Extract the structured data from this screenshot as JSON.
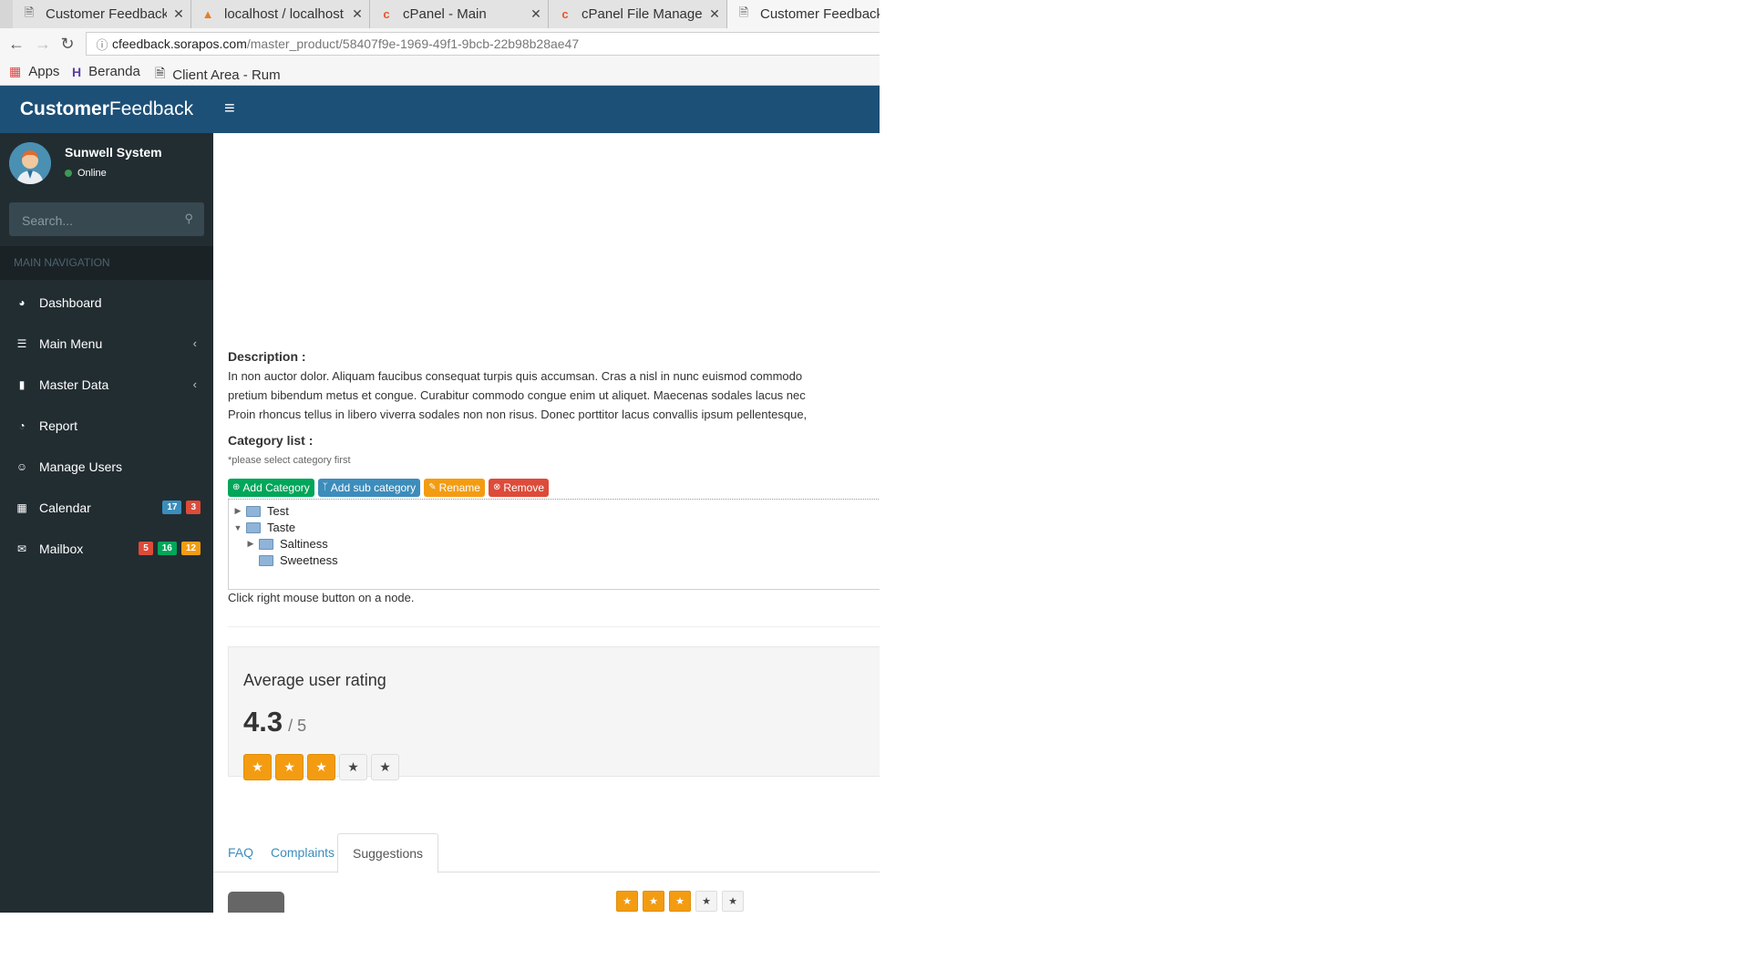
{
  "browser": {
    "tabs": [
      {
        "title": "Customer Feedback",
        "icon": "page-icon"
      },
      {
        "title": "localhost / localhost",
        "icon": "phpmyadmin-icon"
      },
      {
        "title": "cPanel - Main",
        "icon": "cpanel-icon"
      },
      {
        "title": "cPanel File Manager",
        "icon": "cpanel-icon"
      },
      {
        "title": "Customer Feedback",
        "icon": "page-icon"
      }
    ],
    "url_host": "cfeedback.sorapos.com",
    "url_path": "/master_product/58407f9e-1969-49f1-9bcb-22b98b28ae47",
    "bookmarks": [
      "Apps",
      "Beranda",
      "Client Area - Rum"
    ]
  },
  "header": {
    "brand_bold": "Customer",
    "brand_light": "Feedback",
    "colors": {
      "header": "#1d5077",
      "sidebar": "#222d32"
    }
  },
  "sidebar": {
    "user_name": "Sunwell System",
    "status": "Online",
    "search_placeholder": "Search...",
    "nav_header": "MAIN NAVIGATION",
    "items": [
      {
        "label": "Dashboard",
        "icon": "dashboard-icon"
      },
      {
        "label": "Main Menu",
        "icon": "bars-icon",
        "chevron": true
      },
      {
        "label": "Master Data",
        "icon": "book-icon",
        "chevron": true
      },
      {
        "label": "Report",
        "icon": "pie-chart-icon"
      },
      {
        "label": "Manage Users",
        "icon": "user-circle-icon"
      },
      {
        "label": "Calendar",
        "icon": "calendar-icon",
        "badges": [
          {
            "text": "17",
            "color": "#3c8dbc"
          },
          {
            "text": "3",
            "color": "#dd4b39"
          }
        ]
      },
      {
        "label": "Mailbox",
        "icon": "envelope-icon",
        "badges": [
          {
            "text": "5",
            "color": "#dd4b39"
          },
          {
            "text": "16",
            "color": "#00a65a"
          },
          {
            "text": "12",
            "color": "#f39c12"
          }
        ]
      }
    ]
  },
  "main": {
    "description_label": "Description :",
    "description_lines": [
      "In non auctor dolor. Aliquam faucibus consequat turpis quis accumsan. Cras a nisl in nunc euismod commodo",
      "pretium bibendum metus et congue. Curabitur commodo congue enim ut aliquet. Maecenas sodales lacus nec",
      "Proin rhoncus tellus in libero viverra sodales non non risus. Donec porttitor lacus convallis ipsum pellentesque,"
    ],
    "category_label": "Category list :",
    "category_hint": "*please select category first",
    "tree_buttons": [
      {
        "label": "Add Category",
        "icon": "plus-circle-icon",
        "color": "#00a65a"
      },
      {
        "label": "Add sub category",
        "icon": "code-fork-icon",
        "color": "#3c8dbc"
      },
      {
        "label": "Rename",
        "icon": "pencil-icon",
        "color": "#f39c12"
      },
      {
        "label": "Remove",
        "icon": "times-circle-icon",
        "color": "#dd4b39"
      }
    ],
    "tree": [
      {
        "label": "Test",
        "level": 0,
        "expanded": false,
        "has_children": true
      },
      {
        "label": "Taste",
        "level": 0,
        "expanded": true,
        "has_children": true
      },
      {
        "label": "Saltiness",
        "level": 1,
        "expanded": false,
        "has_children": true
      },
      {
        "label": "Sweetness",
        "level": 1,
        "expanded": false,
        "has_children": false
      }
    ],
    "tree_note": "Click right mouse button on a node.",
    "rating": {
      "title": "Average user rating",
      "score": "4.3",
      "out_of": "/ 5",
      "stars_filled": 3,
      "stars_total": 5
    },
    "tabs": [
      "FAQ",
      "Complaints",
      "Suggestions"
    ],
    "active_tab": "Suggestions",
    "entry_stars_filled": 3,
    "entry_stars_total": 5
  }
}
